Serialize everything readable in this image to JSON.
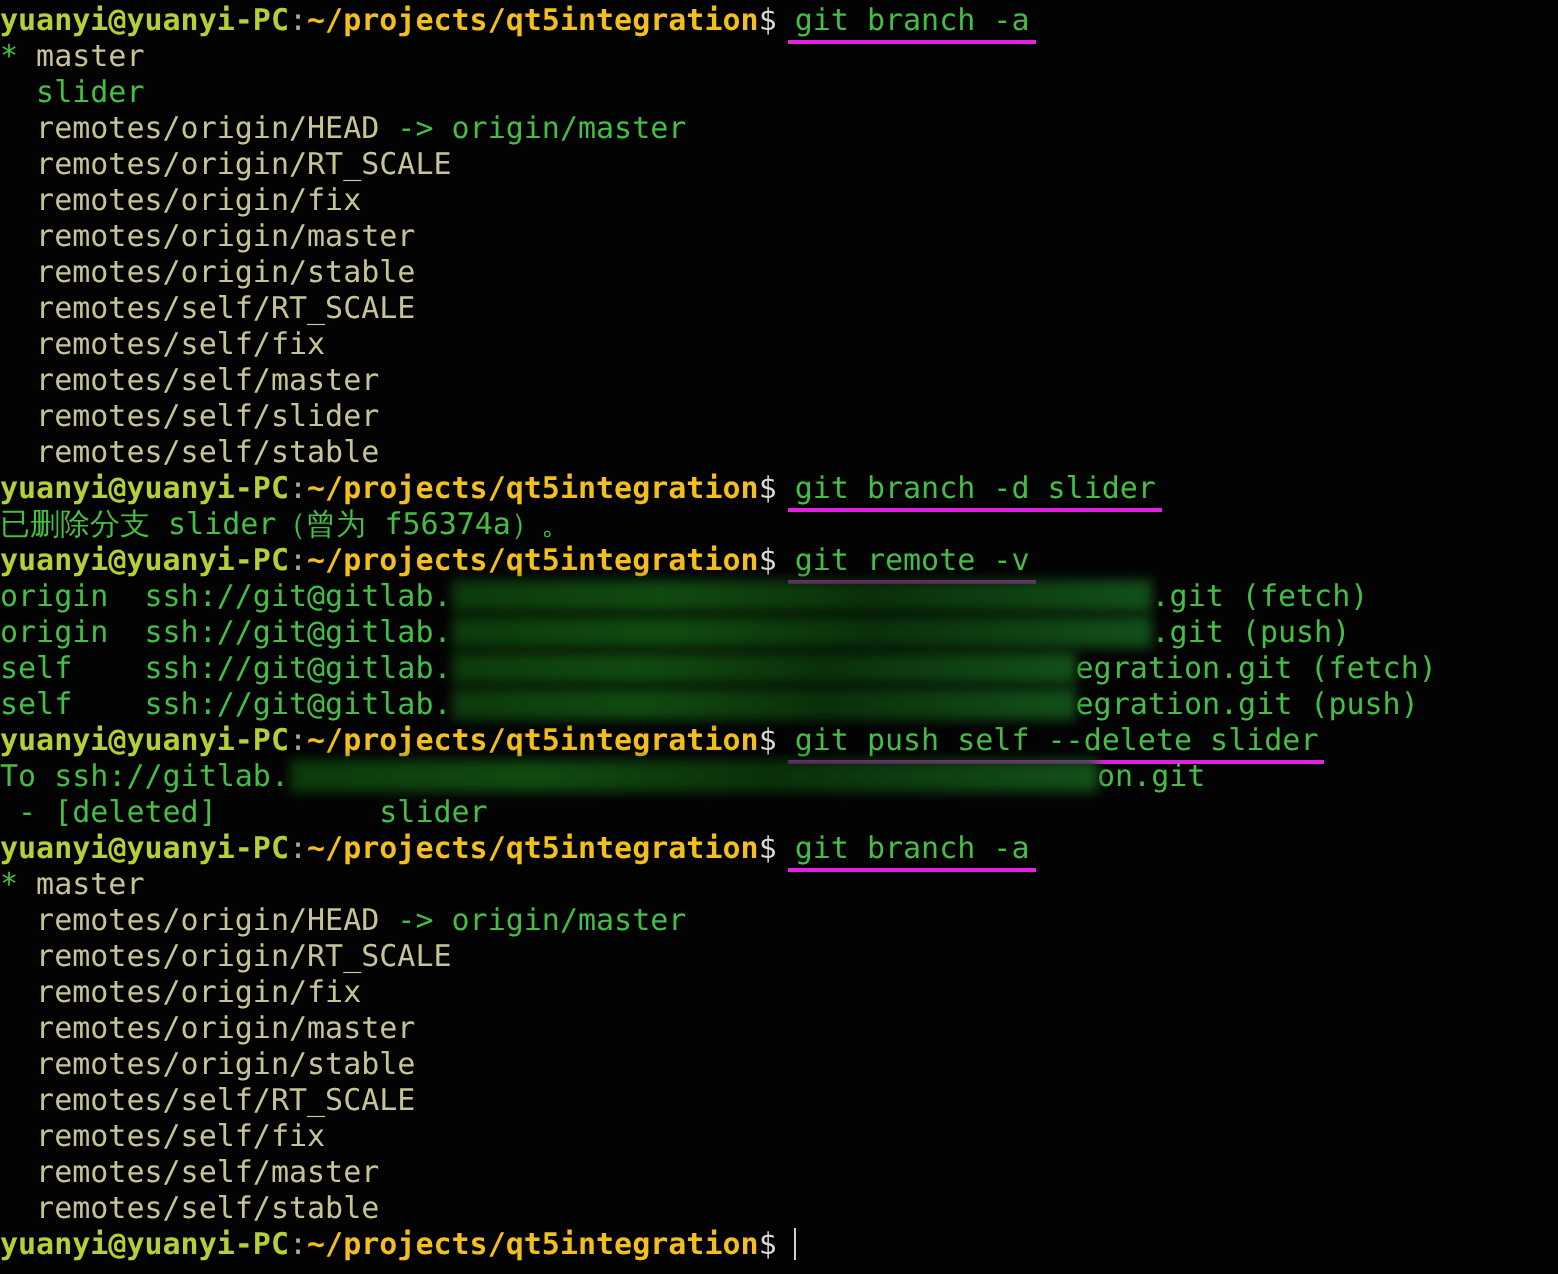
{
  "terminal": {
    "lines": [
      {
        "segments": [
          {
            "text": "yuanyi@yuanyi-PC",
            "kind": "user"
          },
          {
            "text": ":",
            "kind": "sep"
          },
          {
            "text": "~/projects/qt5integration",
            "kind": "path"
          },
          {
            "text": "$",
            "kind": "symbol"
          },
          {
            "text": "git branch -a",
            "kind": "command",
            "underlined": true
          }
        ]
      },
      {
        "segments": [
          {
            "text": "*",
            "kind": "green"
          },
          {
            "text": " master",
            "kind": "output"
          }
        ]
      },
      {
        "segments": [
          {
            "text": "  slider",
            "kind": "green"
          }
        ]
      },
      {
        "segments": [
          {
            "text": "  remotes/origin/HEAD",
            "kind": "output"
          },
          {
            "text": " -> origin/master",
            "kind": "green"
          }
        ]
      },
      {
        "segments": [
          {
            "text": "  remotes/origin/RT_SCALE",
            "kind": "output"
          }
        ]
      },
      {
        "segments": [
          {
            "text": "  remotes/origin/fix",
            "kind": "output"
          }
        ]
      },
      {
        "segments": [
          {
            "text": "  remotes/origin/master",
            "kind": "output"
          }
        ]
      },
      {
        "segments": [
          {
            "text": "  remotes/origin/stable",
            "kind": "output"
          }
        ]
      },
      {
        "segments": [
          {
            "text": "  remotes/self/RT_SCALE",
            "kind": "output"
          }
        ]
      },
      {
        "segments": [
          {
            "text": "  remotes/self/fix",
            "kind": "output"
          }
        ]
      },
      {
        "segments": [
          {
            "text": "  remotes/self/master",
            "kind": "output"
          }
        ]
      },
      {
        "segments": [
          {
            "text": "  remotes/self/slider",
            "kind": "output"
          }
        ]
      },
      {
        "segments": [
          {
            "text": "  remotes/self/stable",
            "kind": "output"
          }
        ]
      },
      {
        "segments": [
          {
            "text": "yuanyi@yuanyi-PC",
            "kind": "user"
          },
          {
            "text": ":",
            "kind": "sep"
          },
          {
            "text": "~/projects/qt5integration",
            "kind": "path"
          },
          {
            "text": "$",
            "kind": "symbol"
          },
          {
            "text": "git branch -d slider",
            "kind": "command",
            "underlined": true
          }
        ]
      },
      {
        "segments": [
          {
            "text": "已删除分支 slider（曾为 f56374a）。",
            "kind": "green"
          }
        ]
      },
      {
        "segments": [
          {
            "text": "yuanyi@yuanyi-PC",
            "kind": "user"
          },
          {
            "text": ":",
            "kind": "sep"
          },
          {
            "text": "~/projects/qt5integration",
            "kind": "path"
          },
          {
            "text": "$",
            "kind": "symbol"
          },
          {
            "text": "git remote -v",
            "kind": "command",
            "underlined": true
          }
        ]
      },
      {
        "segments": [
          {
            "text": "origin  ssh://git@gitlab.",
            "kind": "green"
          },
          {
            "kind": "redacted"
          },
          {
            "text": ".git (fetch)",
            "kind": "green"
          }
        ]
      },
      {
        "segments": [
          {
            "text": "origin  ssh://git@gitlab.",
            "kind": "green"
          },
          {
            "kind": "redacted"
          },
          {
            "text": ".git (push)",
            "kind": "green"
          }
        ]
      },
      {
        "segments": [
          {
            "text": "self    ssh://git@gitlab.",
            "kind": "green"
          },
          {
            "kind": "redacted"
          },
          {
            "text": "egration.git (fetch)",
            "kind": "green"
          }
        ]
      },
      {
        "segments": [
          {
            "text": "self    ssh://git@gitlab.",
            "kind": "green"
          },
          {
            "kind": "redacted"
          },
          {
            "text": "egration.git (push)",
            "kind": "green"
          }
        ]
      },
      {
        "segments": [
          {
            "text": "yuanyi@yuanyi-PC",
            "kind": "user"
          },
          {
            "text": ":",
            "kind": "sep"
          },
          {
            "text": "~/projects/qt5integration",
            "kind": "path"
          },
          {
            "text": "$",
            "kind": "symbol"
          },
          {
            "text": "git push self --delete slider",
            "kind": "command",
            "underlined": true
          }
        ]
      },
      {
        "segments": [
          {
            "text": "To ssh://gitlab.",
            "kind": "green"
          },
          {
            "kind": "redacted"
          },
          {
            "text": "on.git",
            "kind": "green"
          }
        ]
      },
      {
        "segments": [
          {
            "text": " - [deleted]         slider",
            "kind": "green"
          }
        ]
      },
      {
        "segments": [
          {
            "text": "yuanyi@yuanyi-PC",
            "kind": "user"
          },
          {
            "text": ":",
            "kind": "sep"
          },
          {
            "text": "~/projects/qt5integration",
            "kind": "path"
          },
          {
            "text": "$",
            "kind": "symbol"
          },
          {
            "text": "git branch -a",
            "kind": "command",
            "underlined": true
          }
        ]
      },
      {
        "segments": [
          {
            "text": "*",
            "kind": "green"
          },
          {
            "text": " master",
            "kind": "output"
          }
        ]
      },
      {
        "segments": [
          {
            "text": "  remotes/origin/HEAD",
            "kind": "output"
          },
          {
            "text": " -> origin/master",
            "kind": "green"
          }
        ]
      },
      {
        "segments": [
          {
            "text": "  remotes/origin/RT_SCALE",
            "kind": "output"
          }
        ]
      },
      {
        "segments": [
          {
            "text": "  remotes/origin/fix",
            "kind": "output"
          }
        ]
      },
      {
        "segments": [
          {
            "text": "  remotes/origin/master",
            "kind": "output"
          }
        ]
      },
      {
        "segments": [
          {
            "text": "  remotes/origin/stable",
            "kind": "output"
          }
        ]
      },
      {
        "segments": [
          {
            "text": "  remotes/self/RT_SCALE",
            "kind": "output"
          }
        ]
      },
      {
        "segments": [
          {
            "text": "  remotes/self/fix",
            "kind": "output"
          }
        ]
      },
      {
        "segments": [
          {
            "text": "  remotes/self/master",
            "kind": "output"
          }
        ]
      },
      {
        "segments": [
          {
            "text": "  remotes/self/stable",
            "kind": "output"
          }
        ]
      },
      {
        "segments": [
          {
            "text": "yuanyi@yuanyi-PC",
            "kind": "user"
          },
          {
            "text": ":",
            "kind": "sep"
          },
          {
            "text": "~/projects/qt5integration",
            "kind": "path"
          },
          {
            "text": "$",
            "kind": "symbol"
          },
          {
            "kind": "cursor"
          }
        ]
      }
    ]
  }
}
